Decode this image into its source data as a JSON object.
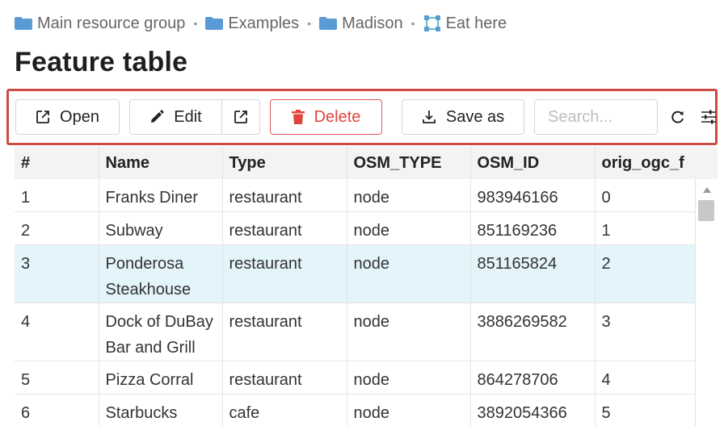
{
  "breadcrumb": {
    "items": [
      {
        "label": "Main resource group",
        "icon": "folder-icon"
      },
      {
        "label": "Examples",
        "icon": "folder-icon"
      },
      {
        "label": "Madison",
        "icon": "folder-icon"
      },
      {
        "label": "Eat here",
        "icon": "vector-layer-icon"
      }
    ],
    "separator": "•"
  },
  "page": {
    "title": "Feature table"
  },
  "toolbar": {
    "open_label": "Open",
    "edit_label": "Edit",
    "delete_label": "Delete",
    "save_as_label": "Save as",
    "search_placeholder": "Search...",
    "delete_color": "#e0453c",
    "highlight_border_color": "#cc4b43"
  },
  "table": {
    "columns": [
      "#",
      "Name",
      "Type",
      "OSM_TYPE",
      "OSM_ID",
      "orig_ogc_f"
    ],
    "rows": [
      {
        "n": "1",
        "name": "Franks Diner",
        "type": "restaurant",
        "osm_type": "node",
        "osm_id": "983946166",
        "orig": "0"
      },
      {
        "n": "2",
        "name": "Subway",
        "type": "restaurant",
        "osm_type": "node",
        "osm_id": "851169236",
        "orig": "1"
      },
      {
        "n": "3",
        "name": "Ponderosa Steakhouse",
        "type": "restaurant",
        "osm_type": "node",
        "osm_id": "851165824",
        "orig": "2"
      },
      {
        "n": "4",
        "name": "Dock of DuBay Bar and Grill",
        "type": "restaurant",
        "osm_type": "node",
        "osm_id": "3886269582",
        "orig": "3"
      },
      {
        "n": "5",
        "name": "Pizza Corral",
        "type": "restaurant",
        "osm_type": "node",
        "osm_id": "864278706",
        "orig": "4"
      },
      {
        "n": "6",
        "name": "Starbucks",
        "type": "cafe",
        "osm_type": "node",
        "osm_id": "3892054366",
        "orig": "5"
      }
    ],
    "selected_row": 3,
    "selected_row_color": "#e3f4fb"
  }
}
